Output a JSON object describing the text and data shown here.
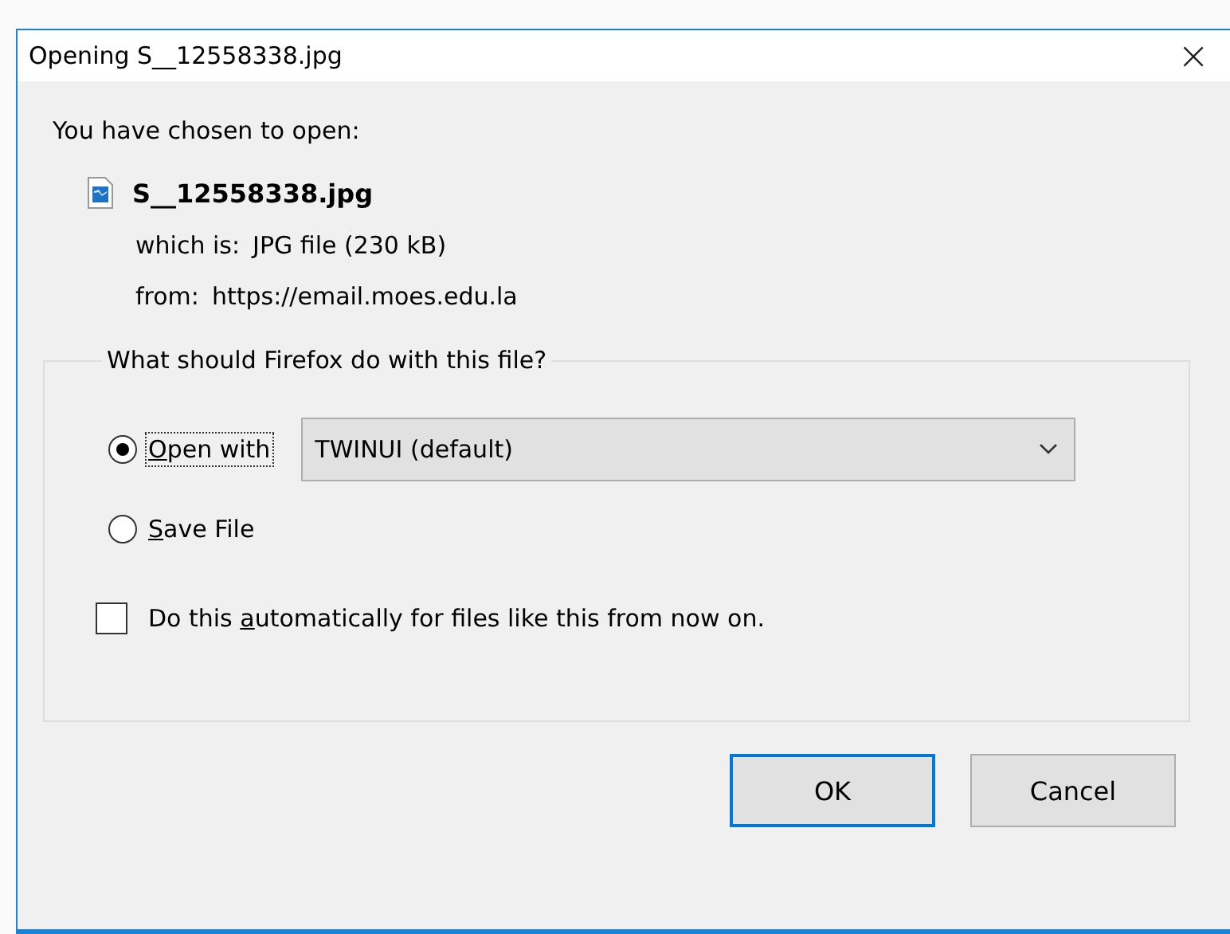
{
  "window": {
    "title": "Opening S__12558338.jpg",
    "close": "×"
  },
  "intro": "You have chosen to open:",
  "file": {
    "name": "S__12558338.jpg",
    "type_label": "which is:",
    "type": "JPG file (230 kB)",
    "from_label": "from:",
    "from": "https://email.moes.edu.la"
  },
  "group": {
    "legend": "What should Firefox do with this file?",
    "options": [
      {
        "accel": "O",
        "post": "pen with",
        "selected": true,
        "focused": true
      },
      {
        "accel": "S",
        "post": "ave File",
        "selected": false,
        "focused": false
      }
    ],
    "app_select": {
      "value": "TWINUI (default)"
    },
    "auto": {
      "pre": "Do this ",
      "accel": "a",
      "post": "utomatically for files like this from now on.",
      "checked": false
    }
  },
  "buttons": [
    {
      "label": "OK",
      "default": true
    },
    {
      "label": "Cancel",
      "default": false
    }
  ]
}
